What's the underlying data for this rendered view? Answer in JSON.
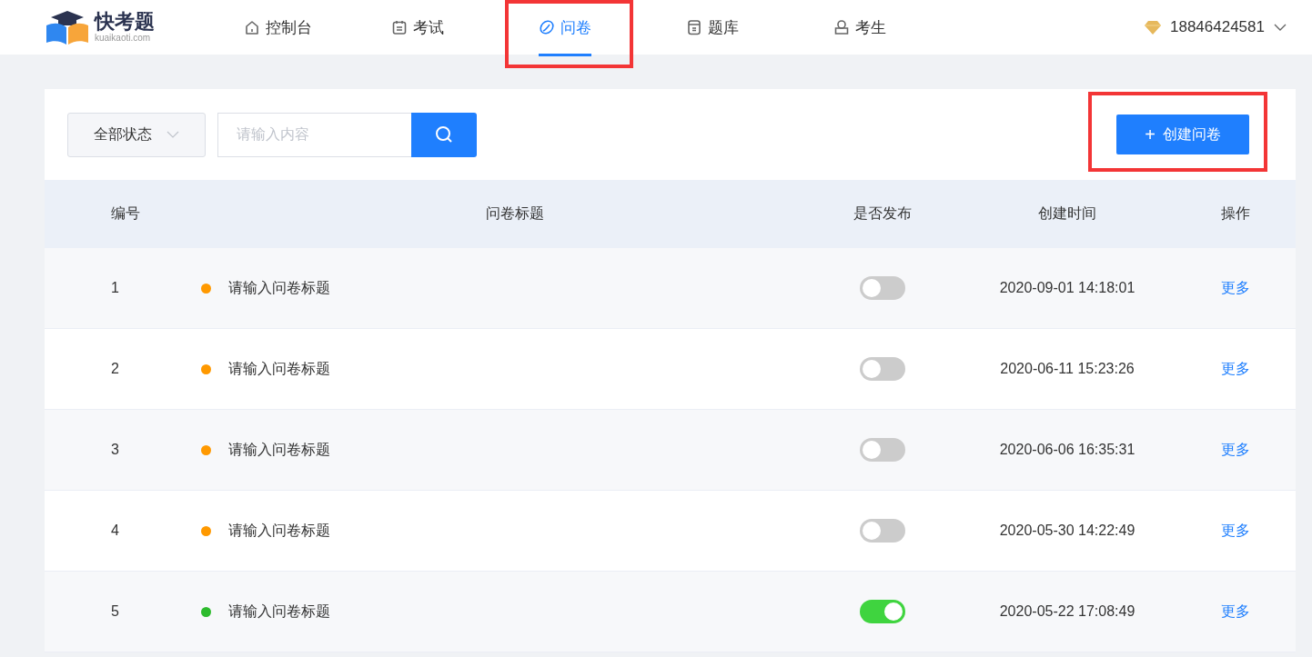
{
  "header": {
    "logo": {
      "title": "快考题",
      "subtitle": "kuaikaoti.com"
    },
    "nav": [
      {
        "label": "控制台",
        "kind": "home",
        "selected": false,
        "highlighted": false
      },
      {
        "label": "考试",
        "kind": "calendar",
        "selected": false,
        "highlighted": false
      },
      {
        "label": "问卷",
        "kind": "leaf",
        "selected": true,
        "highlighted": true
      },
      {
        "label": "题库",
        "kind": "book",
        "selected": false,
        "highlighted": false
      },
      {
        "label": "考生",
        "kind": "person",
        "selected": false,
        "highlighted": false
      }
    ],
    "user": {
      "phone": "18846424581"
    }
  },
  "toolbar": {
    "status_filter": "全部状态",
    "search": {
      "placeholder": "请输入内容"
    },
    "create_button": {
      "label": "创建问卷",
      "icon": "+",
      "highlighted": true
    }
  },
  "table": {
    "columns": [
      "编号",
      "问卷标题",
      "是否发布",
      "创建时间",
      "操作"
    ],
    "rows": [
      {
        "number": "1",
        "title": "请输入问卷标题",
        "color": "#ff9900",
        "on": false,
        "created": "2020-09-01 14:18:01",
        "action": "更多"
      },
      {
        "number": "2",
        "title": "请输入问卷标题",
        "color": "#ff9900",
        "on": false,
        "created": "2020-06-11 15:23:26",
        "action": "更多"
      },
      {
        "number": "3",
        "title": "请输入问卷标题",
        "color": "#ff9900",
        "on": false,
        "created": "2020-06-06 16:35:31",
        "action": "更多"
      },
      {
        "number": "4",
        "title": "请输入问卷标题",
        "color": "#ff9900",
        "on": false,
        "created": "2020-05-30 14:22:49",
        "action": "更多"
      },
      {
        "number": "5",
        "title": "请输入问卷标题",
        "color": "#2dbb2d",
        "on": true,
        "created": "2020-05-22 17:08:49",
        "action": "更多"
      }
    ]
  }
}
